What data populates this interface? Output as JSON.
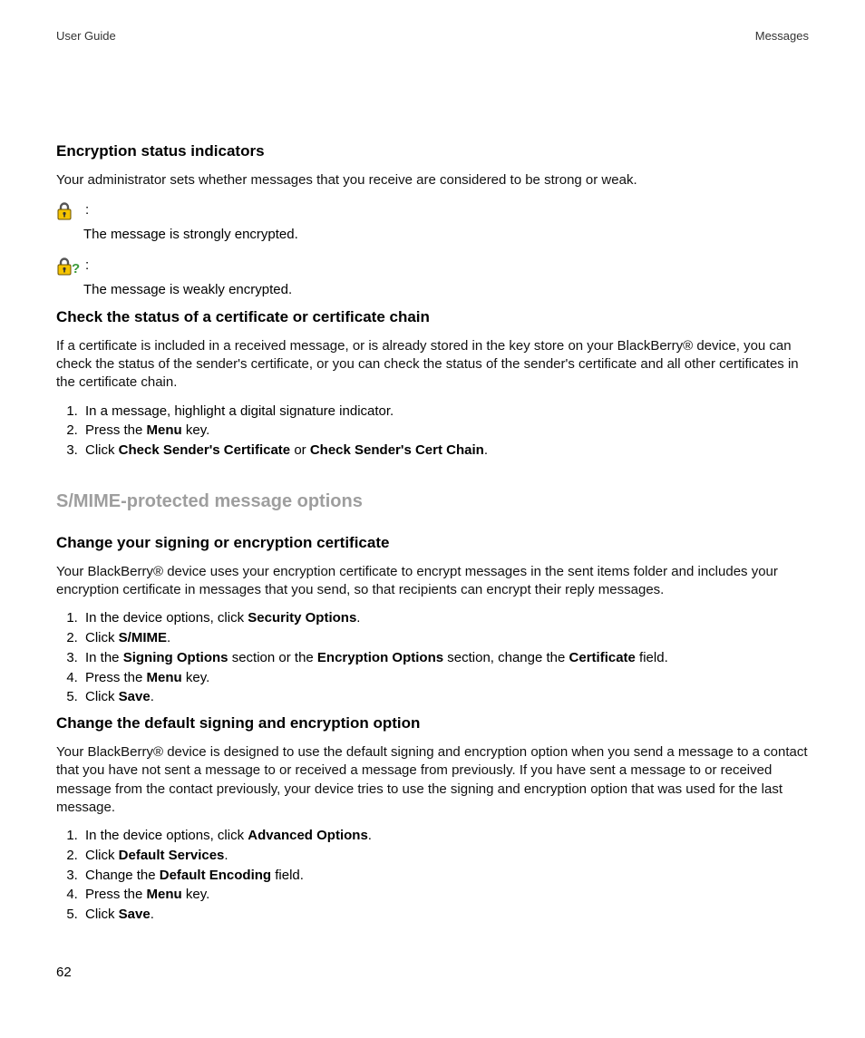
{
  "header": {
    "left": "User Guide",
    "right": "Messages"
  },
  "page_number": "62",
  "section1": {
    "title": "Encryption status indicators",
    "intro": "Your administrator sets whether messages that you receive are considered to be strong or weak.",
    "indicator_strong": "The message is strongly encrypted.",
    "indicator_weak": "The message is weakly encrypted.",
    "colon": ":"
  },
  "section2": {
    "title": "Check the status of a certificate or certificate chain",
    "intro": "If a certificate is included in a received message, or is already stored in the key store on your BlackBerry® device, you can check the status of the sender's certificate, or you can check the status of the sender's certificate and all other certificates in the certificate chain.",
    "steps": {
      "s1": "In a message, highlight a digital signature indicator.",
      "s2a": "Press the ",
      "s2b": "Menu",
      "s2c": " key.",
      "s3a": "Click ",
      "s3b": "Check Sender's Certificate",
      "s3c": " or ",
      "s3d": "Check Sender's Cert Chain",
      "s3e": "."
    }
  },
  "major_title": "S/MIME-protected message options",
  "section3": {
    "title": "Change your signing or encryption certificate",
    "intro": "Your BlackBerry® device uses your encryption certificate to encrypt messages in the sent items folder and includes your encryption certificate in messages that you send, so that recipients can encrypt their reply messages.",
    "steps": {
      "s1a": "In the device options, click ",
      "s1b": "Security Options",
      "s1c": ".",
      "s2a": "Click ",
      "s2b": "S/MIME",
      "s2c": ".",
      "s3a": "In the ",
      "s3b": "Signing Options",
      "s3c": " section or the ",
      "s3d": "Encryption Options",
      "s3e": " section, change the ",
      "s3f": "Certificate",
      "s3g": " field.",
      "s4a": "Press the ",
      "s4b": "Menu",
      "s4c": " key.",
      "s5a": "Click ",
      "s5b": "Save",
      "s5c": "."
    }
  },
  "section4": {
    "title": "Change the default signing and encryption option",
    "intro": "Your BlackBerry® device is designed to use the default signing and encryption option when you send a message to a contact that you have not sent a message to or received a message from previously. If you have sent a message to or received message from the contact previously, your device tries to use the signing and encryption option that was used for the last message.",
    "steps": {
      "s1a": "In the device options, click ",
      "s1b": "Advanced Options",
      "s1c": ".",
      "s2a": "Click ",
      "s2b": "Default Services",
      "s2c": ".",
      "s3a": "Change the ",
      "s3b": "Default Encoding",
      "s3c": " field.",
      "s4a": "Press the ",
      "s4b": "Menu",
      "s4c": " key.",
      "s5a": "Click ",
      "s5b": "Save",
      "s5c": "."
    }
  }
}
